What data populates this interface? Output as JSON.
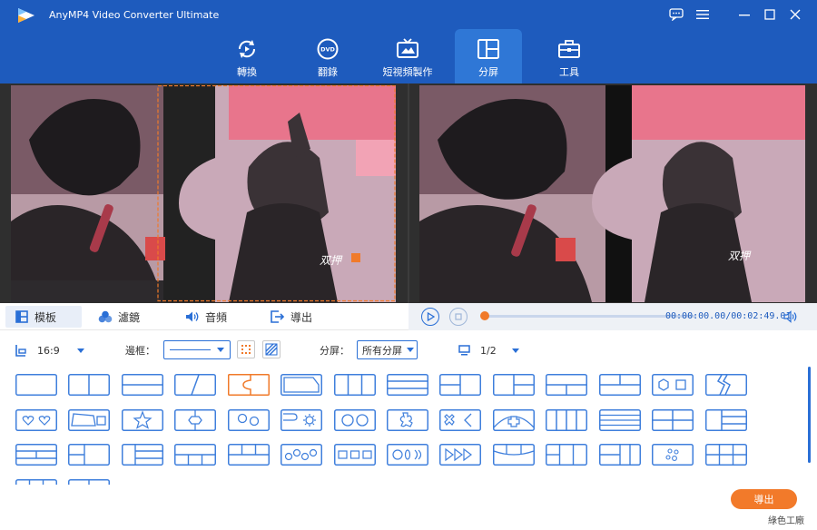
{
  "window": {
    "title": "AnyMP4 Video Converter Ultimate",
    "controls": [
      "feedback-icon",
      "menu-icon",
      "minimize-icon",
      "maximize-icon",
      "close-icon"
    ]
  },
  "nav_tabs": [
    {
      "label": "轉換",
      "icon": "convert-icon",
      "active": false
    },
    {
      "label": "翻錄",
      "icon": "dvd-icon",
      "active": false
    },
    {
      "label": "短視頻製作",
      "icon": "mv-icon",
      "active": false
    },
    {
      "label": "分屏",
      "icon": "split-screen-icon",
      "active": true
    },
    {
      "label": "工具",
      "icon": "toolbox-icon",
      "active": false
    }
  ],
  "panel_tabs": [
    {
      "label": "模板",
      "icon": "template-icon",
      "active": true
    },
    {
      "label": "濾鏡",
      "icon": "filter-icon",
      "active": false
    },
    {
      "label": "音頻",
      "icon": "audio-icon",
      "active": false
    },
    {
      "label": "導出",
      "icon": "export-icon",
      "active": false
    }
  ],
  "player": {
    "time": "00:00:00.00/00:02:49.01",
    "progress": 0
  },
  "options": {
    "aspect_ratio": "16:9",
    "border_label": "邊框：",
    "split_label": "分屏：",
    "split_value": "所有分屏",
    "page": "1/2"
  },
  "export_label": "導出",
  "watermark": "綠色工廠",
  "colors": {
    "nav_bar": "#1e5bbd",
    "accent": "#2a6fd6",
    "selected_template": "#f07a2a",
    "export_button": "#f27a2a"
  }
}
